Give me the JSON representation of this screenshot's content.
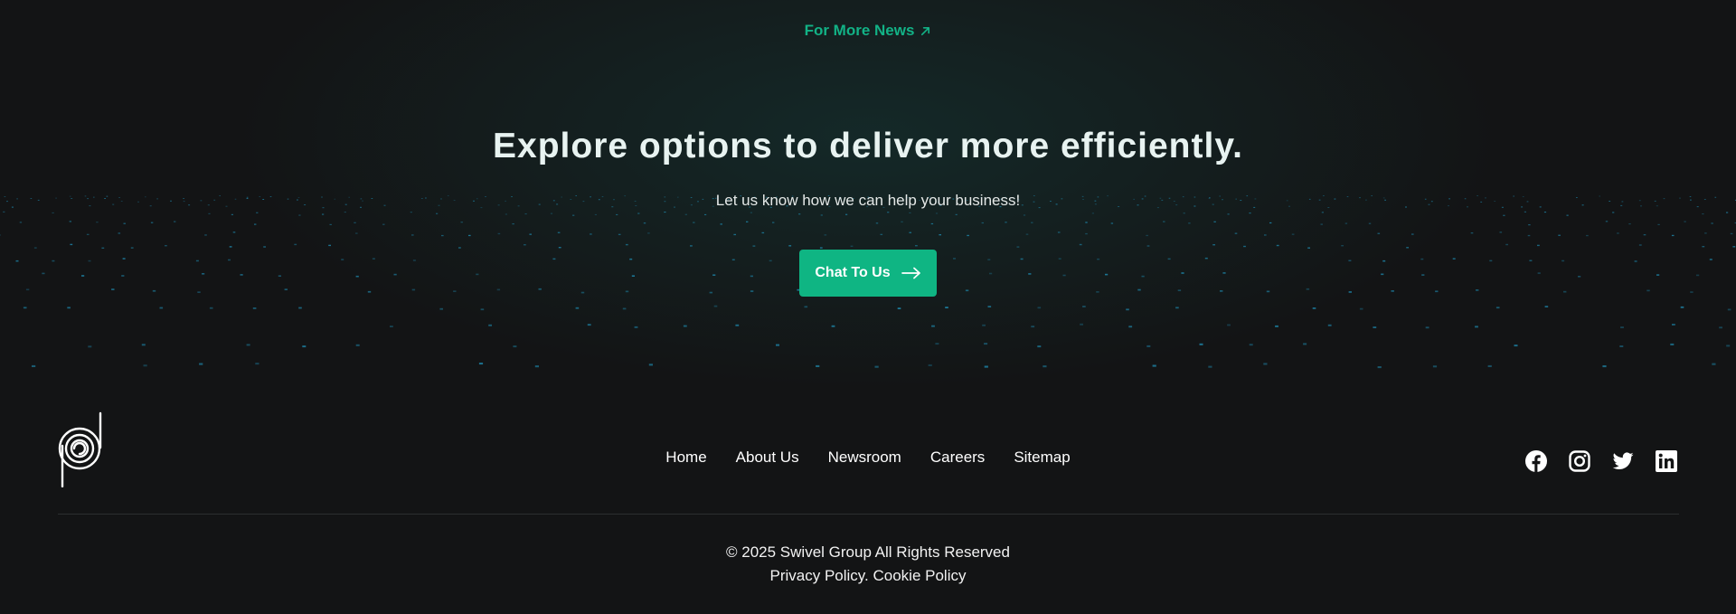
{
  "news": {
    "label": "For More News",
    "icon": "arrow-up-right-icon"
  },
  "hero": {
    "title": "Explore options to deliver more efficiently.",
    "subtitle": "Let us know how we can help your business!",
    "cta_label": "Chat To Us",
    "cta_icon": "arrow-right-icon"
  },
  "footer": {
    "logo_icon": "swivel-logo-icon",
    "nav": [
      {
        "label": "Home"
      },
      {
        "label": "About Us"
      },
      {
        "label": "Newsroom"
      },
      {
        "label": "Careers"
      },
      {
        "label": "Sitemap"
      }
    ],
    "socials": [
      "facebook-icon",
      "instagram-icon",
      "twitter-icon",
      "linkedin-icon"
    ],
    "copyright": "© 2025 Swivel Group All Rights Reserved",
    "privacy": "Privacy Policy",
    "separator": ". ",
    "cookie": "Cookie Policy"
  },
  "colors": {
    "background": "#131415",
    "accent": "#0fb583",
    "accent_text": "#12b286",
    "dot": "#1f8fb5"
  }
}
